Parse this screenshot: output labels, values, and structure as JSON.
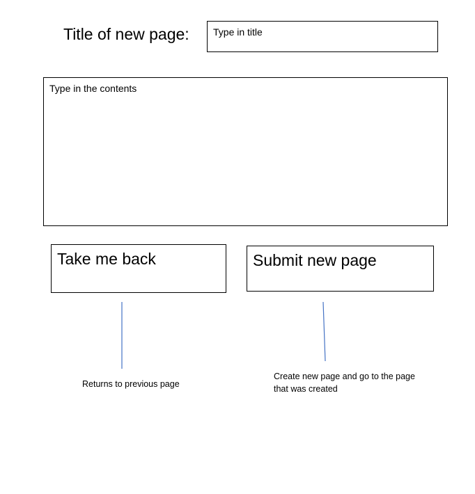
{
  "form": {
    "title_label": "Title of new page:",
    "title_placeholder": "Type in title",
    "contents_placeholder": "Type in the contents"
  },
  "buttons": {
    "back_label": "Take me back",
    "submit_label": "Submit new page"
  },
  "annotations": {
    "back_note": "Returns to previous page",
    "submit_note_lines": [
      "Create new page and go to the page",
      "that was created"
    ]
  },
  "colors": {
    "border": "#000000",
    "connector_line": "#4472c4"
  }
}
